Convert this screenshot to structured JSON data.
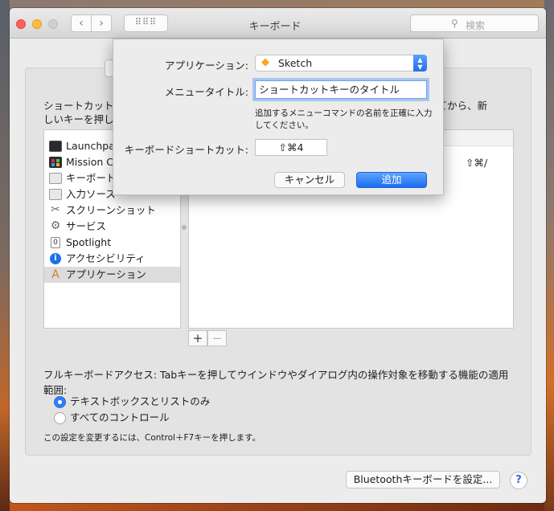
{
  "window": {
    "title": "キーボード",
    "search_placeholder": "検索",
    "nav_back": "‹",
    "nav_forward": "›",
    "grid": "⠿⠿⠿"
  },
  "panel": {
    "instructions_line1": "ショートカット",
    "instructions_line2": "しいキーを押し",
    "instructions_right": "クしてから、新",
    "shortcut_display": "⇧⌘/"
  },
  "list": {
    "items": [
      {
        "label": "Launchpad",
        "icon": "launchpad-icon"
      },
      {
        "label": "Mission C",
        "icon": "mission-control-icon"
      },
      {
        "label": "キーボード",
        "icon": "keyboard-icon"
      },
      {
        "label": "入力ソース",
        "icon": "input-source-icon"
      },
      {
        "label": "スクリーンショット",
        "icon": "screenshot-icon"
      },
      {
        "label": "サービス",
        "icon": "services-gear-icon"
      },
      {
        "label": "Spotlight",
        "icon": "spotlight-icon"
      },
      {
        "label": "アクセシビリティ",
        "icon": "accessibility-icon"
      },
      {
        "label": "アプリケーション",
        "icon": "applications-icon"
      }
    ],
    "selected_index": 8
  },
  "buttons": {
    "plus": "+",
    "minus": "−",
    "bluetooth": "Bluetoothキーボードを設定...",
    "help": "?"
  },
  "full_keyboard_access": {
    "label": "フルキーボードアクセス: Tabキーを押してウインドウやダイアログ内の操作対象を移動する機能の適用範囲:",
    "option1": "テキストボックスとリストのみ",
    "option2": "すべてのコントロール",
    "selected": 0,
    "note": "この設定を変更するには、Control＋F7キーを押します。"
  },
  "sheet": {
    "app_label": "アプリケーション:",
    "app_value": "Sketch",
    "menu_title_label": "メニュータイトル:",
    "menu_title_value": "ショートカットキーのタイトル",
    "hint": "追加するメニューコマンドの名前を正確に入力してください。",
    "shortcut_label": "キーボードショートカット:",
    "shortcut_value": "⇧⌘4",
    "cancel": "キャンセル",
    "add": "追加"
  },
  "colors": {
    "accent": "#1d6cf0",
    "selected_row": "#dcdcdc"
  }
}
